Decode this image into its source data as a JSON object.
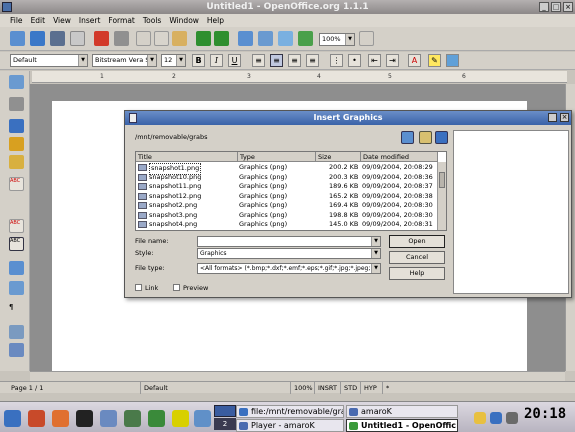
{
  "window": {
    "title": "Untitled1 - OpenOffice.org 1.1.1"
  },
  "menu": [
    "File",
    "Edit",
    "View",
    "Insert",
    "Format",
    "Tools",
    "Window",
    "Help"
  ],
  "toolbar": {
    "zoom": "100%"
  },
  "format_bar": {
    "style": "Default",
    "font": "Bitstream Vera S",
    "size": "12",
    "bold": "B",
    "italic": "I",
    "underline": "U"
  },
  "ruler": {
    "ticks": [
      "1",
      "2",
      "3",
      "4",
      "5",
      "6"
    ]
  },
  "status": {
    "page": "Page 1 / 1",
    "style": "Default",
    "zoom": "100%",
    "mode": "INSRT",
    "selection": "STD",
    "hyperlink": "HYP",
    "modified": "*"
  },
  "dialog": {
    "title": "Insert Graphics",
    "path": "/mnt/removable/grabs",
    "columns": [
      "Title",
      "Type",
      "Size",
      "Date modified"
    ],
    "files": [
      {
        "name": "snapshot1.png",
        "type": "Graphics (png)",
        "size": "200.2 KB",
        "date": "09/09/2004, 20:08:29"
      },
      {
        "name": "snapshot10.png",
        "type": "Graphics (png)",
        "size": "200.3 KB",
        "date": "09/09/2004, 20:08:36"
      },
      {
        "name": "snapshot11.png",
        "type": "Graphics (png)",
        "size": "189.6 KB",
        "date": "09/09/2004, 20:08:37"
      },
      {
        "name": "snapshot12.png",
        "type": "Graphics (png)",
        "size": "165.2 KB",
        "date": "09/09/2004, 20:08:38"
      },
      {
        "name": "snapshot2.png",
        "type": "Graphics (png)",
        "size": "169.4 KB",
        "date": "09/09/2004, 20:08:30"
      },
      {
        "name": "snapshot3.png",
        "type": "Graphics (png)",
        "size": "198.8 KB",
        "date": "09/09/2004, 20:08:30"
      },
      {
        "name": "snapshot4.png",
        "type": "Graphics (png)",
        "size": "145.0 KB",
        "date": "09/09/2004, 20:08:31"
      }
    ],
    "file_name_label": "File name:",
    "file_name_value": "",
    "style_label": "Style:",
    "style_value": "Graphics",
    "file_type_label": "File type:",
    "file_type_value": "<All formats> (*.bmp;*.dxf;*.emf;*.eps;*.gif;*.jpg;*.jpeg;",
    "link_label": "Link",
    "preview_label": "Preview",
    "open_label": "Open",
    "cancel_label": "Cancel",
    "help_label": "Help"
  },
  "taskbar": {
    "desktop_number": "2",
    "tasks": [
      "file:/mnt/removable/gra",
      "amaroK",
      "Player - amaroK",
      "Untitled1 - OpenOffic"
    ],
    "clock": "20:18"
  }
}
